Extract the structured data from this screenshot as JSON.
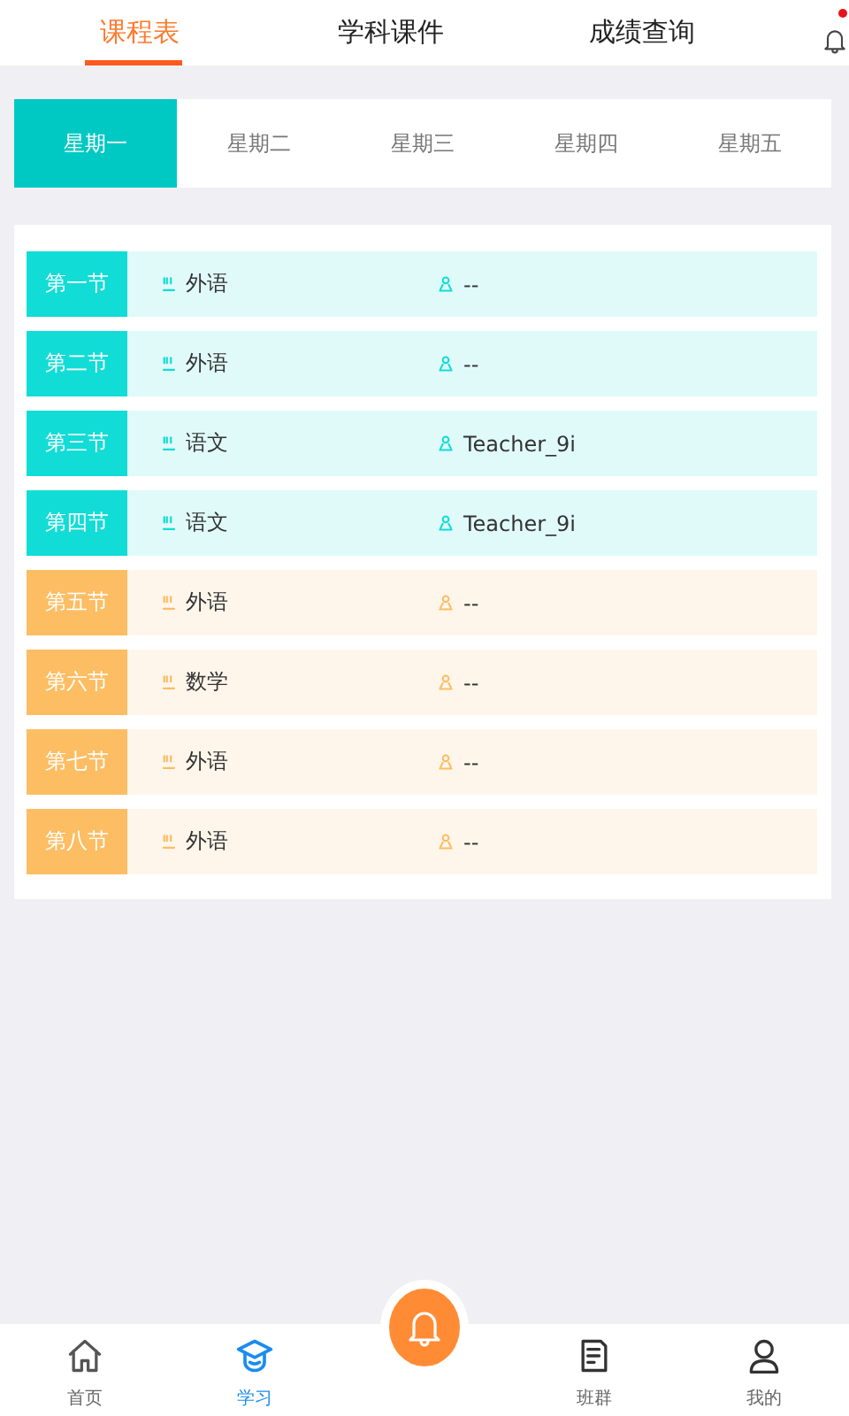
{
  "top_tabs": [
    {
      "label": "课程表",
      "selected": true
    },
    {
      "label": "学科课件",
      "selected": false
    },
    {
      "label": "成绩查询",
      "selected": false
    }
  ],
  "notification": {
    "unread": true
  },
  "days": [
    {
      "label": "星期一",
      "selected": true
    },
    {
      "label": "星期二",
      "selected": false
    },
    {
      "label": "星期三",
      "selected": false
    },
    {
      "label": "星期四",
      "selected": false
    },
    {
      "label": "星期五",
      "selected": false
    }
  ],
  "lessons": [
    {
      "period": "第一节",
      "subject": "外语",
      "teacher": "--",
      "color": "#12dcd6"
    },
    {
      "period": "第二节",
      "subject": "外语",
      "teacher": "--",
      "color": "#12dcd6"
    },
    {
      "period": "第三节",
      "subject": "语文",
      "teacher": "Teacher_9i",
      "color": "#12dcd6"
    },
    {
      "period": "第四节",
      "subject": "语文",
      "teacher": "Teacher_9i",
      "color": "#12dcd6"
    },
    {
      "period": "第五节",
      "subject": "外语",
      "teacher": "--",
      "color": "#fdbd63"
    },
    {
      "period": "第六节",
      "subject": "数学",
      "teacher": "--",
      "color": "#fdbd63"
    },
    {
      "period": "第七节",
      "subject": "外语",
      "teacher": "--",
      "color": "#fdbd63"
    },
    {
      "period": "第八节",
      "subject": "外语",
      "teacher": "--",
      "color": "#fdbd63"
    }
  ],
  "bottom_nav": [
    {
      "label": "首页",
      "kind": "home",
      "selected": false
    },
    {
      "label": "学习",
      "kind": "study",
      "selected": true
    },
    {
      "kind": "alarm"
    },
    {
      "label": "班群",
      "kind": "group",
      "selected": false
    },
    {
      "label": "我的",
      "kind": "me",
      "selected": false
    }
  ]
}
